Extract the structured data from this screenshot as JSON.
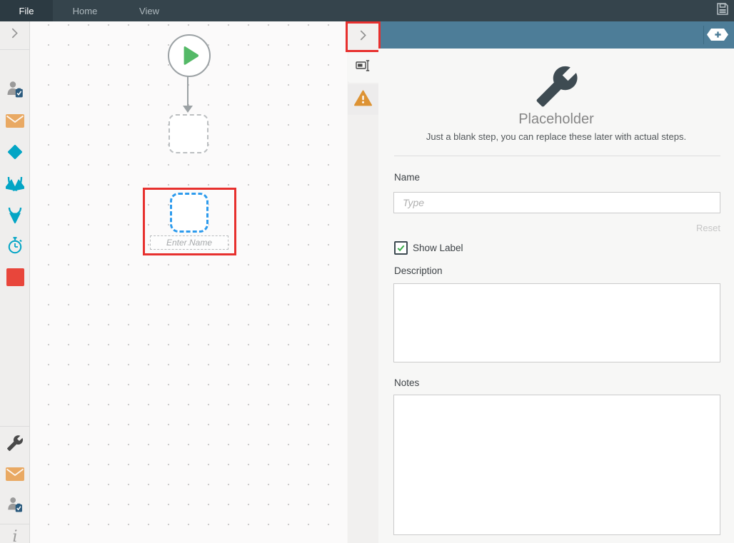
{
  "menubar": {
    "tabs": [
      {
        "label": "File",
        "active": true
      },
      {
        "label": "Home",
        "active": false
      },
      {
        "label": "View",
        "active": false
      }
    ],
    "save_icon": "floppy-disk-icon"
  },
  "toolbox": {
    "collapse_icon": "chevron-right-icon",
    "step_icons": [
      "user-task-icon",
      "mail-icon",
      "decision-diamond-icon",
      "split-arrows-icon",
      "merge-arrow-icon",
      "timer-icon",
      "stop-square-icon"
    ],
    "footer_icons": [
      "wrench-icon",
      "mail-icon",
      "user-task-icon",
      "info-icon"
    ],
    "info_glyph": "i"
  },
  "canvas": {
    "start_node_icon": "play-icon",
    "selected_node_name_placeholder": "Enter Name",
    "selection_highlight_color": "#e7302e",
    "selected_node_border_color": "#2d9bed"
  },
  "panel": {
    "collapse_icon": "chevron-right-icon",
    "add_step_icon": "plus-badge-icon",
    "tabs": [
      {
        "icon": "rename-icon",
        "active": true
      },
      {
        "icon": "warning-icon",
        "active": false
      }
    ],
    "step": {
      "icon": "wrench-icon",
      "title": "Placeholder",
      "subtitle": "Just a blank step, you can replace these later with actual steps."
    },
    "form": {
      "name_label": "Name",
      "name_value": "",
      "name_placeholder": "Type",
      "reset_label": "Reset",
      "show_label_label": "Show Label",
      "show_label_checked": true,
      "description_label": "Description",
      "description_value": "",
      "notes_label": "Notes",
      "notes_value": ""
    }
  },
  "colors": {
    "topbar": "#35444c",
    "panel_header": "#4d7d98",
    "accent_teal": "#03a5c5",
    "mail_orange": "#e9a963",
    "warning_orange": "#dd9334",
    "play_green": "#54b967",
    "stop_red": "#e8463b",
    "selection_red": "#e7302e",
    "node_blue": "#2d9bed"
  }
}
